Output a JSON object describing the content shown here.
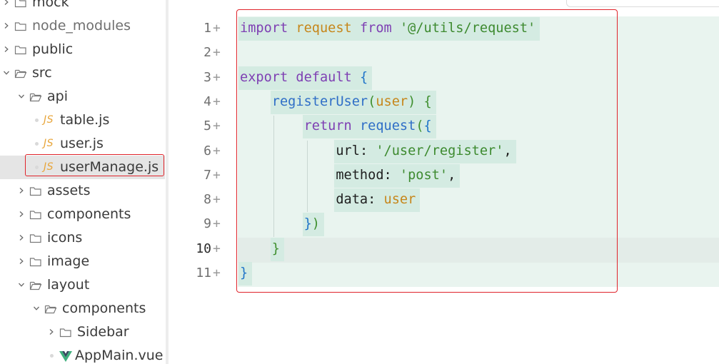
{
  "file_tree": {
    "items": [
      {
        "label": "mock",
        "kind": "folder",
        "expanded": false
      },
      {
        "label": "node_modules",
        "kind": "folder",
        "expanded": false
      },
      {
        "label": "public",
        "kind": "folder",
        "expanded": false
      },
      {
        "label": "src",
        "kind": "folder",
        "expanded": true
      },
      {
        "label": "api",
        "kind": "folder",
        "expanded": true
      },
      {
        "label": "table.js",
        "kind": "js-file",
        "icon_text": "JS"
      },
      {
        "label": "user.js",
        "kind": "js-file",
        "icon_text": "JS"
      },
      {
        "label": "userManage.js",
        "kind": "js-file",
        "icon_text": "JS",
        "selected": true
      },
      {
        "label": "assets",
        "kind": "folder",
        "expanded": false
      },
      {
        "label": "components",
        "kind": "folder",
        "expanded": false
      },
      {
        "label": "icons",
        "kind": "folder",
        "expanded": false
      },
      {
        "label": "image",
        "kind": "folder",
        "expanded": false
      },
      {
        "label": "layout",
        "kind": "folder",
        "expanded": true
      },
      {
        "label": "components",
        "kind": "folder",
        "expanded": true
      },
      {
        "label": "Sidebar",
        "kind": "folder",
        "expanded": false
      },
      {
        "label": "AppMain.vue",
        "kind": "vue-file"
      }
    ]
  },
  "editor": {
    "active_line": 10,
    "line_change_marker": "+",
    "lines": [
      {
        "number": "1",
        "tokens": [
          {
            "text": "import",
            "kind": "keyword"
          },
          {
            "text": " ",
            "kind": "plain"
          },
          {
            "text": "request",
            "kind": "identifier"
          },
          {
            "text": " ",
            "kind": "plain"
          },
          {
            "text": "from",
            "kind": "keyword"
          },
          {
            "text": " ",
            "kind": "plain"
          },
          {
            "text": "'@/utils/request'",
            "kind": "string"
          }
        ]
      },
      {
        "number": "2",
        "tokens": []
      },
      {
        "number": "3",
        "tokens": [
          {
            "text": "export",
            "kind": "keyword"
          },
          {
            "text": " ",
            "kind": "plain"
          },
          {
            "text": "default",
            "kind": "keyword"
          },
          {
            "text": " ",
            "kind": "plain"
          },
          {
            "text": "{",
            "kind": "bracket1"
          }
        ]
      },
      {
        "number": "4",
        "tokens": [
          {
            "text": "    ",
            "kind": "plain"
          },
          {
            "text": "registerUser",
            "kind": "function"
          },
          {
            "text": "(",
            "kind": "bracket2"
          },
          {
            "text": "user",
            "kind": "identifier"
          },
          {
            "text": ")",
            "kind": "bracket2"
          },
          {
            "text": " ",
            "kind": "plain"
          },
          {
            "text": "{",
            "kind": "bracket2"
          }
        ]
      },
      {
        "number": "5",
        "tokens": [
          {
            "text": "        ",
            "kind": "plain"
          },
          {
            "text": "return",
            "kind": "keyword"
          },
          {
            "text": " ",
            "kind": "plain"
          },
          {
            "text": "request",
            "kind": "function"
          },
          {
            "text": "(",
            "kind": "bracket2"
          },
          {
            "text": "{",
            "kind": "bracket1"
          }
        ]
      },
      {
        "number": "6",
        "tokens": [
          {
            "text": "            ",
            "kind": "plain"
          },
          {
            "text": "url",
            "kind": "plain"
          },
          {
            "text": ": ",
            "kind": "plain"
          },
          {
            "text": "'/user/register'",
            "kind": "string"
          },
          {
            "text": ",",
            "kind": "plain"
          }
        ]
      },
      {
        "number": "7",
        "tokens": [
          {
            "text": "            ",
            "kind": "plain"
          },
          {
            "text": "method",
            "kind": "plain"
          },
          {
            "text": ": ",
            "kind": "plain"
          },
          {
            "text": "'post'",
            "kind": "string"
          },
          {
            "text": ",",
            "kind": "plain"
          }
        ]
      },
      {
        "number": "8",
        "tokens": [
          {
            "text": "            ",
            "kind": "plain"
          },
          {
            "text": "data",
            "kind": "plain"
          },
          {
            "text": ": ",
            "kind": "plain"
          },
          {
            "text": "user",
            "kind": "identifier"
          }
        ]
      },
      {
        "number": "9",
        "tokens": [
          {
            "text": "        ",
            "kind": "plain"
          },
          {
            "text": "}",
            "kind": "bracket1"
          },
          {
            "text": ")",
            "kind": "bracket2"
          }
        ]
      },
      {
        "number": "10",
        "tokens": [
          {
            "text": "    ",
            "kind": "plain"
          },
          {
            "text": "}",
            "kind": "bracket2"
          }
        ]
      },
      {
        "number": "11",
        "tokens": [
          {
            "text": "}",
            "kind": "bracket1"
          }
        ]
      }
    ]
  },
  "colors": {
    "highlight_box": "#e0242b",
    "added_block_bg": "#e9f4ef",
    "keyword": "#7e3fb3",
    "string": "#3d8a2f",
    "function": "#2f6ec7",
    "identifier": "#c6861a"
  }
}
